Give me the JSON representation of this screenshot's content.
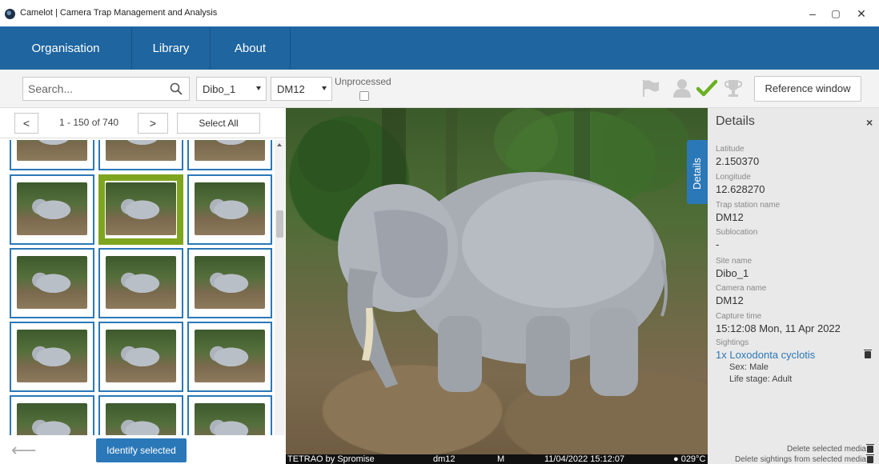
{
  "window": {
    "title": "Camelot | Camera Trap Management and Analysis",
    "minimize": "–",
    "maximize": "▢",
    "close": "✕"
  },
  "nav": {
    "items": [
      {
        "label": "Organisation"
      },
      {
        "label": "Library"
      },
      {
        "label": "About"
      }
    ]
  },
  "toolbar": {
    "search_placeholder": "Search...",
    "site_select": "Dibo_1",
    "camera_select": "DM12",
    "unprocessed_label": "Unprocessed",
    "unprocessed_checked": false,
    "icons": [
      "flag-icon",
      "user-icon",
      "checkmark-icon",
      "trophy-icon"
    ],
    "reference_button": "Reference window"
  },
  "library": {
    "prev": "<",
    "next": ">",
    "range": "1 - 150 of 740",
    "select_all": "Select All",
    "back": "⟵",
    "identify_button": "Identify selected",
    "thumbnail_rows_visible": 5,
    "selected_row": 1,
    "selected_col": 1
  },
  "image_caption": {
    "camera_brand": "TETRAO by Spromise",
    "camera_id": "dm12",
    "mode": "M",
    "timestamp": "11/04/2022 15:12:07",
    "temp": "● 029°C"
  },
  "details": {
    "tab_label": "Details",
    "title": "Details",
    "close": "×",
    "fields": [
      {
        "label": "Latitude",
        "value": "2.150370"
      },
      {
        "label": "Longitude",
        "value": "12.628270"
      },
      {
        "label": "Trap station name",
        "value": "DM12"
      },
      {
        "label": "Sublocation",
        "value": "-"
      },
      {
        "label": "Site name",
        "value": "Dibo_1"
      },
      {
        "label": "Camera name",
        "value": "DM12"
      },
      {
        "label": "Capture time",
        "value": "15:12:08 Mon, 11 Apr 2022"
      }
    ],
    "sightings_label": "Sightings",
    "sighting": "1x Loxodonta cyclotis",
    "sex": "Sex: Male",
    "life_stage": "Life stage: Adult",
    "delete_media": "Delete selected media",
    "delete_sightings": "Delete sightings from selected media"
  },
  "colors": {
    "nav_bg": "#1f65a0",
    "accent": "#2b78b8",
    "selected_thumb": "#7fa51e",
    "check_green": "#6ab023"
  }
}
